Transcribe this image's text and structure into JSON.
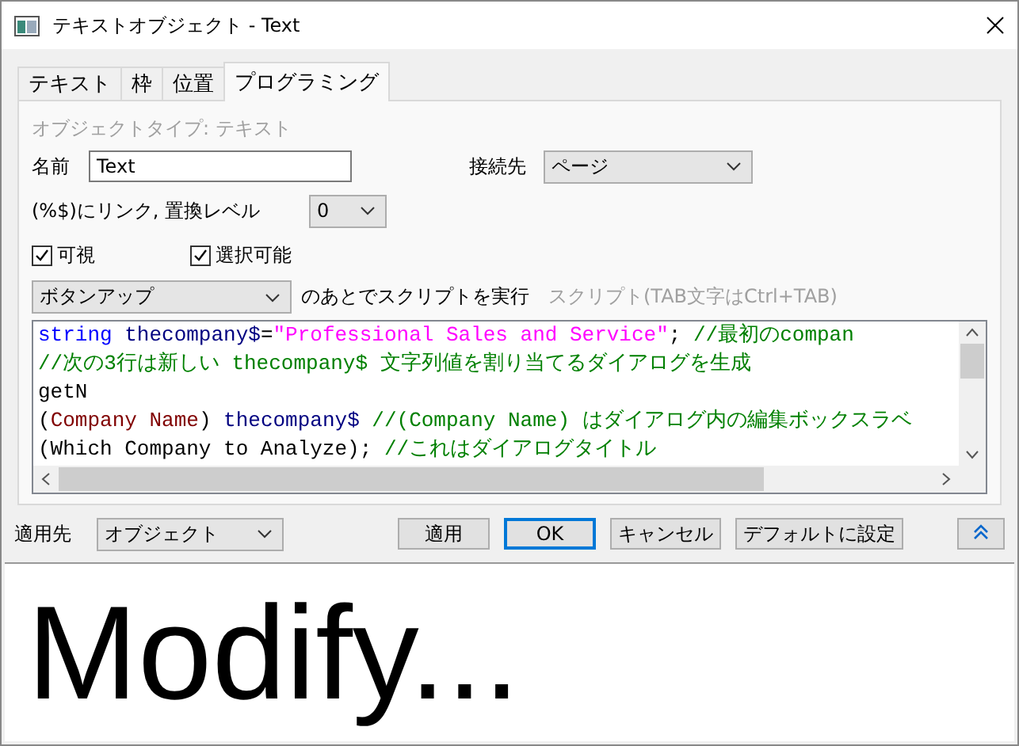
{
  "window": {
    "title": "テキストオブジェクト - Text"
  },
  "tabs": [
    {
      "label": "テキスト",
      "selected": false
    },
    {
      "label": "枠",
      "selected": false
    },
    {
      "label": "位置",
      "selected": false
    },
    {
      "label": "プログラミング",
      "selected": true
    }
  ],
  "object_type": "オブジェクトタイプ: テキスト",
  "name": {
    "label": "名前",
    "value": "Text"
  },
  "attach_to": {
    "label": "接続先",
    "value": "ページ"
  },
  "link_level": {
    "label": "(%$)にリンク, 置換レベル",
    "value": "0"
  },
  "checkboxes": [
    {
      "label": "可視",
      "checked": true
    },
    {
      "label": "選択可能",
      "checked": true
    }
  ],
  "script_trigger": {
    "value": "ボタンアップ",
    "label": "のあとでスクリプトを実行",
    "hint": "スクリプト(TAB文字はCtrl+TAB)"
  },
  "script_lines": [
    [
      {
        "kind": "keyword",
        "text": "string"
      },
      {
        "kind": "variable",
        "text": " thecompany$"
      },
      {
        "kind": "plain",
        "text": "="
      },
      {
        "kind": "string",
        "text": "\"Professional Sales and Service\""
      },
      {
        "kind": "plain",
        "text": ";"
      },
      {
        "kind": "comment",
        "text": " //最初のcompan"
      }
    ],
    [
      {
        "kind": "comment",
        "text": "//次の3行は新しい thecompany$ 文字列値を割り当てるダイアログを生成"
      }
    ],
    [
      {
        "kind": "plain",
        "text": "getN"
      }
    ],
    [
      {
        "kind": "plain",
        "text": "("
      },
      {
        "kind": "label",
        "text": "Company Name"
      },
      {
        "kind": "plain",
        "text": ")"
      },
      {
        "kind": "variable",
        "text": " thecompany$"
      },
      {
        "kind": "comment",
        "text": " //(Company Name) はダイアログ内の編集ボックスラベ"
      }
    ],
    [
      {
        "kind": "plain",
        "text": "(Which Company to Analyze);"
      },
      {
        "kind": "comment",
        "text": " //これはダイアログタイトル"
      }
    ]
  ],
  "apply_to": {
    "label": "適用先",
    "value": "オブジェクト"
  },
  "buttons": [
    {
      "label": "適用",
      "default": false
    },
    {
      "label": "OK",
      "default": true
    },
    {
      "label": "キャンセル",
      "default": false
    },
    {
      "label": "デフォルトに設定",
      "default": false
    }
  ],
  "preview": {
    "text": "Modify..."
  }
}
